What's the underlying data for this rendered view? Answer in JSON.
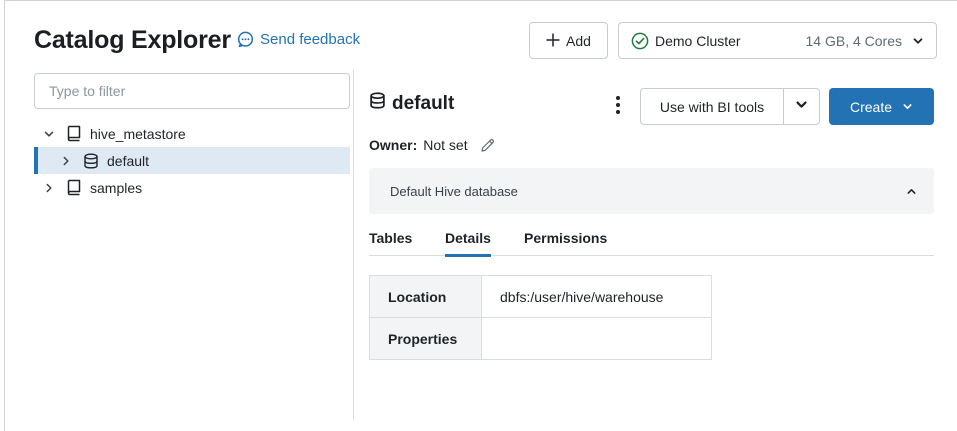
{
  "header": {
    "title": "Catalog Explorer",
    "feedback_label": "Send feedback",
    "add_label": "Add",
    "cluster_name": "Demo Cluster",
    "cluster_spec": "14 GB, 4 Cores"
  },
  "sidebar": {
    "filter_placeholder": "Type to filter",
    "tree": [
      {
        "label": "hive_metastore",
        "expanded": true,
        "icon": "catalog-icon"
      },
      {
        "label": "default",
        "expanded": false,
        "selected": true,
        "icon": "database-icon"
      },
      {
        "label": "samples",
        "expanded": false,
        "icon": "catalog-icon"
      }
    ]
  },
  "main": {
    "db_name": "default",
    "bi_label": "Use with BI tools",
    "create_label": "Create",
    "owner_label": "Owner:",
    "owner_value": "Not set",
    "description": "Default Hive database",
    "tabs": [
      {
        "label": "Tables"
      },
      {
        "label": "Details",
        "active": true
      },
      {
        "label": "Permissions"
      }
    ],
    "details": [
      {
        "key": "Location",
        "value": "dbfs:/user/hive/warehouse"
      },
      {
        "key": "Properties",
        "value": ""
      }
    ]
  },
  "colors": {
    "accent": "#2272b4",
    "selected_row_bg": "#dfe9f3",
    "panel_bg": "#f3f4f5"
  }
}
